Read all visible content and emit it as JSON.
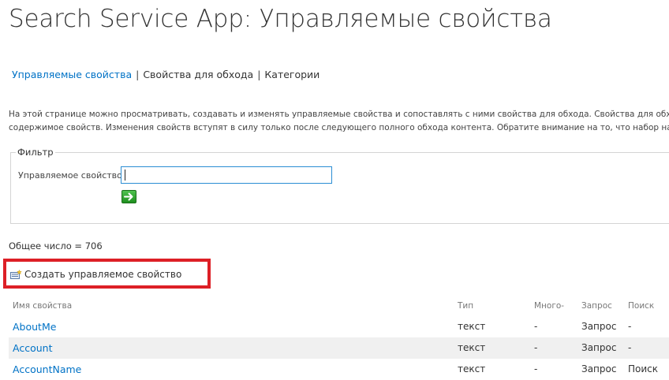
{
  "page_title": "Search Service App: Управляемые свойства",
  "nav": {
    "items": [
      {
        "label": "Управляемые свойства",
        "active": true
      },
      {
        "label": "Свойства для обхода",
        "active": false
      },
      {
        "label": "Категории",
        "active": false
      }
    ],
    "separator": "|"
  },
  "description": {
    "line1": "На этой странице можно просматривать, создавать и изменять управляемые свойства и сопоставлять с ними свойства для обхода. Свойства для обхода ав",
    "line2": "содержимое свойств. Изменения свойств вступят в силу только после следующего полного обхода контента. Обратите внимание на то, что набор настраи"
  },
  "filter": {
    "legend": "Фильтр",
    "label": "Управляемое свойство",
    "input_value": "",
    "input_placeholder": "",
    "go_icon": "arrow-right-icon"
  },
  "total_count": "Общее число = 706",
  "new_property": {
    "label": "Создать управляемое свойство",
    "icon": "new-property-icon"
  },
  "table": {
    "headers": {
      "name": "Имя свойства",
      "type": "Тип",
      "multi": "Много-",
      "query": "Запрос",
      "search": "Поиск"
    },
    "rows": [
      {
        "name": "AboutMe",
        "type": "текст",
        "multi": "-",
        "query": "Запрос",
        "search": "-"
      },
      {
        "name": "Account",
        "type": "текст",
        "multi": "-",
        "query": "Запрос",
        "search": "-"
      },
      {
        "name": "AccountName",
        "type": "текст",
        "multi": "-",
        "query": "Запрос",
        "search": "Поиск"
      }
    ]
  },
  "colors": {
    "link": "#0072c6",
    "highlight": "#dd1f26",
    "input_border": "#2a8dd4",
    "go_button": "#2aa52a",
    "alt_row": "#f0f0f0"
  }
}
